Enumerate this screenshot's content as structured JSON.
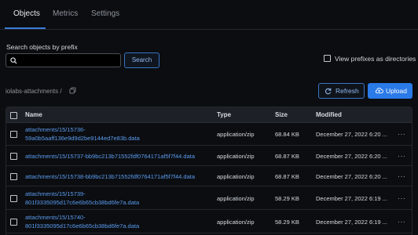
{
  "tabs": [
    {
      "label": "Objects",
      "active": true
    },
    {
      "label": "Metrics",
      "active": false
    },
    {
      "label": "Settings",
      "active": false
    }
  ],
  "search": {
    "label": "Search objects by prefix",
    "placeholder": "",
    "value": "",
    "button_label": "Search"
  },
  "view_prefixes": {
    "label": "View prefixes as directories",
    "checked": false
  },
  "breadcrumb": "iolabs-attachments /",
  "toolbar": {
    "refresh_label": "Refresh",
    "upload_label": "Upload"
  },
  "table": {
    "columns": [
      "Name",
      "Type",
      "Size",
      "Modified"
    ],
    "rows": [
      {
        "name_line1": "attachments/15/15736-",
        "name_line2": "59a0b5aaff136e9d9d2be9144ed7e83b.data",
        "type": "application/zip",
        "size": "68.84 KB",
        "modified": "December 27, 2022 6:20 ..."
      },
      {
        "name_line1": "attachments/15/15737-bb9bc213b71552fdf0764171af5f7f44.data",
        "name_line2": "",
        "type": "application/zip",
        "size": "68.87 KB",
        "modified": "December 27, 2022 6:20 ..."
      },
      {
        "name_line1": "attachments/15/15738-bb9bc213b71552fdf0764171af5f7f44.data",
        "name_line2": "",
        "type": "application/zip",
        "size": "68.87 KB",
        "modified": "December 27, 2022 6:20 ..."
      },
      {
        "name_line1": "attachments/15/15739-",
        "name_line2": "801f3335095d17c6e6b65cb38bd6fe7a.data",
        "type": "application/zip",
        "size": "58.29 KB",
        "modified": "December 27, 2022 6:19 ..."
      },
      {
        "name_line1": "attachments/15/15740-",
        "name_line2": "801f3335095d17c6e6b65cb38bd6fe7a.data",
        "type": "application/zip",
        "size": "58.29 KB",
        "modified": "December 27, 2022 6:19 ..."
      }
    ]
  },
  "row_menu_glyph": "···",
  "colors": {
    "accent": "#2a7ae8",
    "link": "#5b9bef",
    "background": "#0b0d10"
  }
}
